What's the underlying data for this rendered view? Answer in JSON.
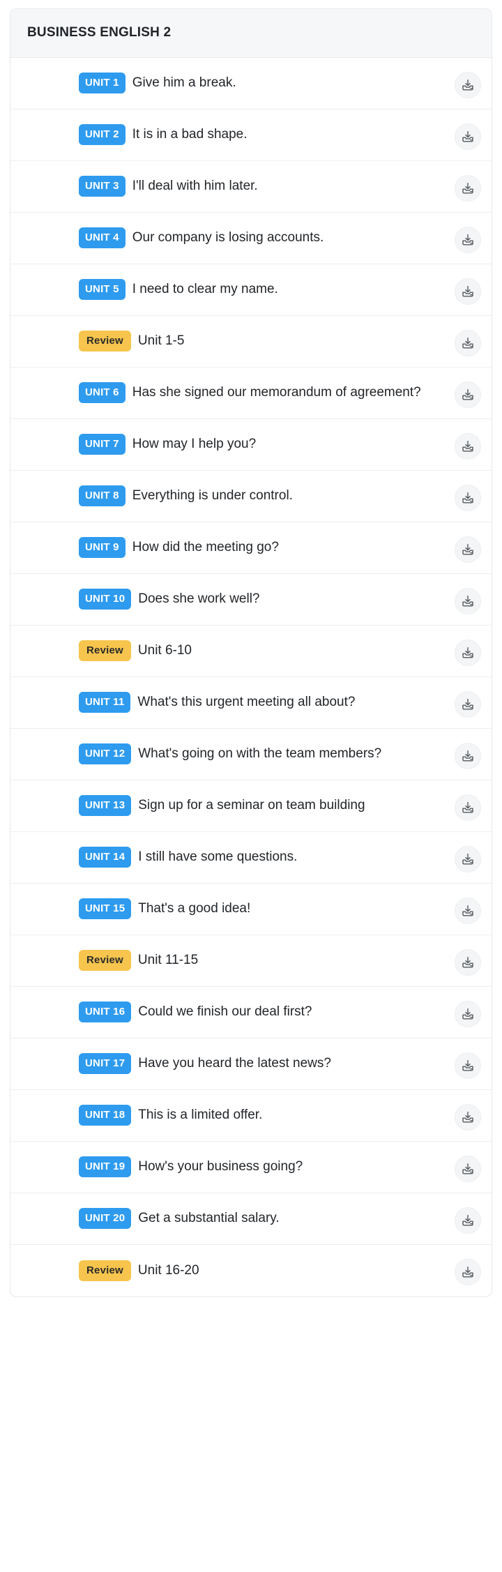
{
  "card": {
    "header": {
      "title": "BUSINESS ENGLISH 2"
    },
    "download_icon_name": "download-tray-icon",
    "colors": {
      "unit_badge_bg": "#2e9bef",
      "unit_badge_text": "#ffffff",
      "review_badge_bg": "#f7c54d",
      "review_badge_text": "#2b2b2b",
      "header_bg": "#f6f7f9",
      "row_text": "#222529",
      "card_border": "#e6e8eb",
      "row_divider": "#eceef0",
      "download_button_bg": "#f4f5f6"
    },
    "rows": [
      {
        "badge": "UNIT 1",
        "type": "unit",
        "text": "Give him a break."
      },
      {
        "badge": "UNIT 2",
        "type": "unit",
        "text": "It is in a bad shape."
      },
      {
        "badge": "UNIT 3",
        "type": "unit",
        "text": "I'll deal with him later."
      },
      {
        "badge": "UNIT 4",
        "type": "unit",
        "text": "Our company is losing accounts."
      },
      {
        "badge": "UNIT 5",
        "type": "unit",
        "text": "I need to clear my name."
      },
      {
        "badge": "Review",
        "type": "review",
        "text": "Unit 1-5"
      },
      {
        "badge": "UNIT 6",
        "type": "unit",
        "text": "Has she signed our memorandum of agreement?"
      },
      {
        "badge": "UNIT 7",
        "type": "unit",
        "text": "How may I help you?"
      },
      {
        "badge": "UNIT 8",
        "type": "unit",
        "text": "Everything is under control."
      },
      {
        "badge": "UNIT 9",
        "type": "unit",
        "text": "How did the meeting go?"
      },
      {
        "badge": "UNIT 10",
        "type": "unit",
        "text": "Does she work well?"
      },
      {
        "badge": "Review",
        "type": "review",
        "text": "Unit 6-10"
      },
      {
        "badge": "UNIT 11",
        "type": "unit",
        "text": "What's this urgent meeting all about?"
      },
      {
        "badge": "UNIT 12",
        "type": "unit",
        "text": "What's going on with the team members?"
      },
      {
        "badge": "UNIT 13",
        "type": "unit",
        "text": "Sign up for a seminar on team building"
      },
      {
        "badge": "UNIT 14",
        "type": "unit",
        "text": "I still have some questions."
      },
      {
        "badge": "UNIT 15",
        "type": "unit",
        "text": "That's a good idea!"
      },
      {
        "badge": "Review",
        "type": "review",
        "text": "Unit 11-15"
      },
      {
        "badge": "UNIT 16",
        "type": "unit",
        "text": "Could we finish our deal first?"
      },
      {
        "badge": "UNIT 17",
        "type": "unit",
        "text": "Have you heard the latest news?"
      },
      {
        "badge": "UNIT 18",
        "type": "unit",
        "text": "This is a limited offer."
      },
      {
        "badge": "UNIT 19",
        "type": "unit",
        "text": "How's your business going?"
      },
      {
        "badge": "UNIT 20",
        "type": "unit",
        "text": "Get a substantial salary."
      },
      {
        "badge": "Review",
        "type": "review",
        "text": "Unit 16-20"
      }
    ]
  }
}
